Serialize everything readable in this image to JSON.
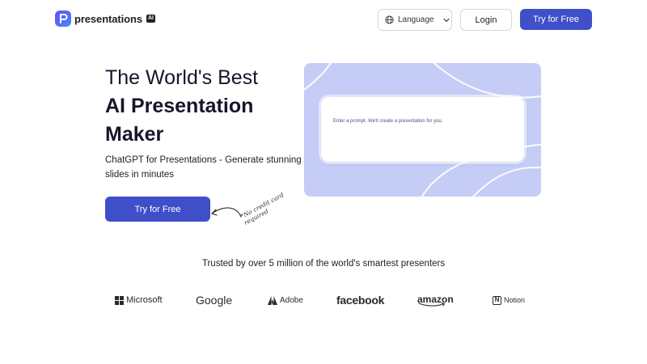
{
  "header": {
    "logo_text": "presentations",
    "logo_badge": "AI",
    "language_label": "Language",
    "login_label": "Login",
    "try_label": "Try for Free"
  },
  "hero": {
    "title_line1": "The World's Best",
    "title_line2": "AI Presentation",
    "title_line3": "Maker",
    "subtitle": "ChatGPT for Presentations - Generate stunning slides in minutes",
    "cta_label": "Try for Free",
    "handwritten_note": "*No credit card required"
  },
  "preview": {
    "prompt_placeholder": "Enter a prompt. We'll create a presentation for you."
  },
  "trusted": {
    "text": "Trusted by over 5 million of the world's smartest presenters",
    "brands": [
      "Microsoft",
      "Google",
      "Adobe",
      "facebook",
      "amazon",
      "Notion"
    ]
  },
  "colors": {
    "accent": "#3f4fc9",
    "panel": "#c5ccf6",
    "text": "#16162a"
  }
}
